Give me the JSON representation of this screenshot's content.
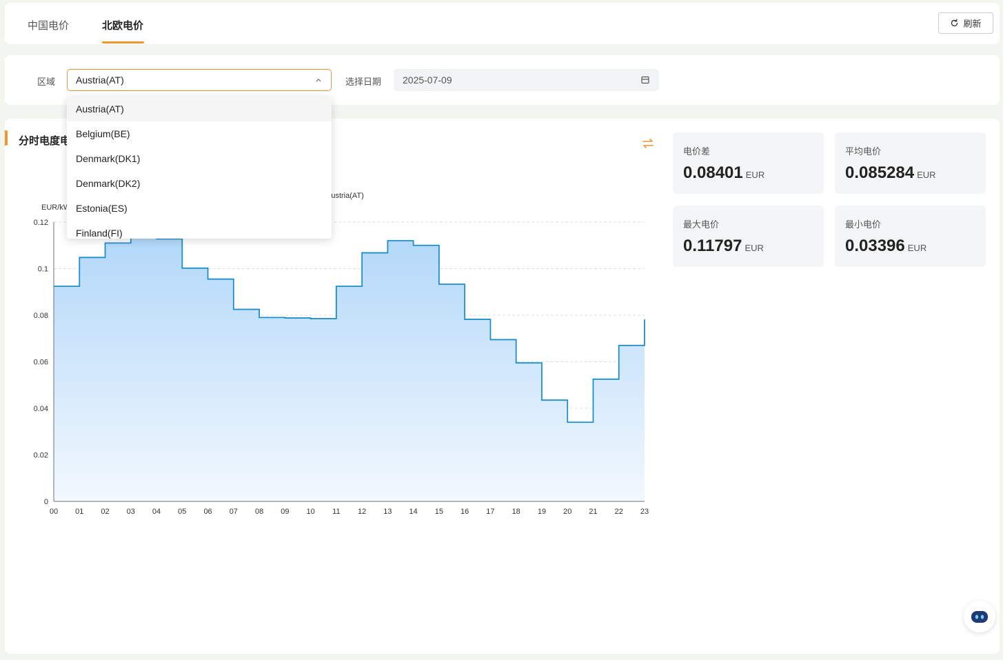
{
  "tabs": [
    {
      "label": "中国电价",
      "active": false
    },
    {
      "label": "北欧电价",
      "active": true
    }
  ],
  "refresh_label": "刷新",
  "filter": {
    "region_label": "区域",
    "region_value": "Austria(AT)",
    "date_label": "选择日期",
    "date_value": "2025-07-09"
  },
  "dropdown": {
    "options": [
      "Austria(AT)",
      "Belgium(BE)",
      "Denmark(DK1)",
      "Denmark(DK2)",
      "Estonia(ES)",
      "Finland(FI)"
    ],
    "selected": "Austria(AT)"
  },
  "section": {
    "title": "分时电度电"
  },
  "stats": [
    {
      "label": "电价差",
      "value": "0.08401",
      "unit": "EUR"
    },
    {
      "label": "平均电价",
      "value": "0.085284",
      "unit": "EUR"
    },
    {
      "label": "最大电价",
      "value": "0.11797",
      "unit": "EUR"
    },
    {
      "label": "最小电价",
      "value": "0.03396",
      "unit": "EUR"
    }
  ],
  "colors": {
    "accent": "#f0962a",
    "line": "#1f8fc9",
    "area_top": "#b3d8f9",
    "area_bottom": "#f2f8fe"
  },
  "chart_data": {
    "type": "area",
    "step": true,
    "ylabel": "EUR/kW",
    "legend": "Austria(AT)",
    "categories": [
      "00",
      "01",
      "02",
      "03",
      "04",
      "05",
      "06",
      "07",
      "08",
      "09",
      "10",
      "11",
      "12",
      "13",
      "14",
      "15",
      "16",
      "17",
      "18",
      "19",
      "20",
      "21",
      "22",
      "23"
    ],
    "series": [
      {
        "name": "Austria(AT)",
        "values": [
          0.0924,
          0.1048,
          0.111,
          0.1135,
          0.1128,
          0.1002,
          0.0955,
          0.0825,
          0.079,
          0.0788,
          0.0785,
          0.0924,
          0.1068,
          0.112,
          0.11,
          0.0933,
          0.0782,
          0.0695,
          0.0595,
          0.0435,
          0.034,
          0.0525,
          0.067,
          0.0782
        ]
      }
    ],
    "ylim": [
      0,
      0.12
    ],
    "yticks": [
      "0",
      "0.02",
      "0.04",
      "0.06",
      "0.08",
      "0.1",
      "0.12"
    ],
    "grid": true
  }
}
